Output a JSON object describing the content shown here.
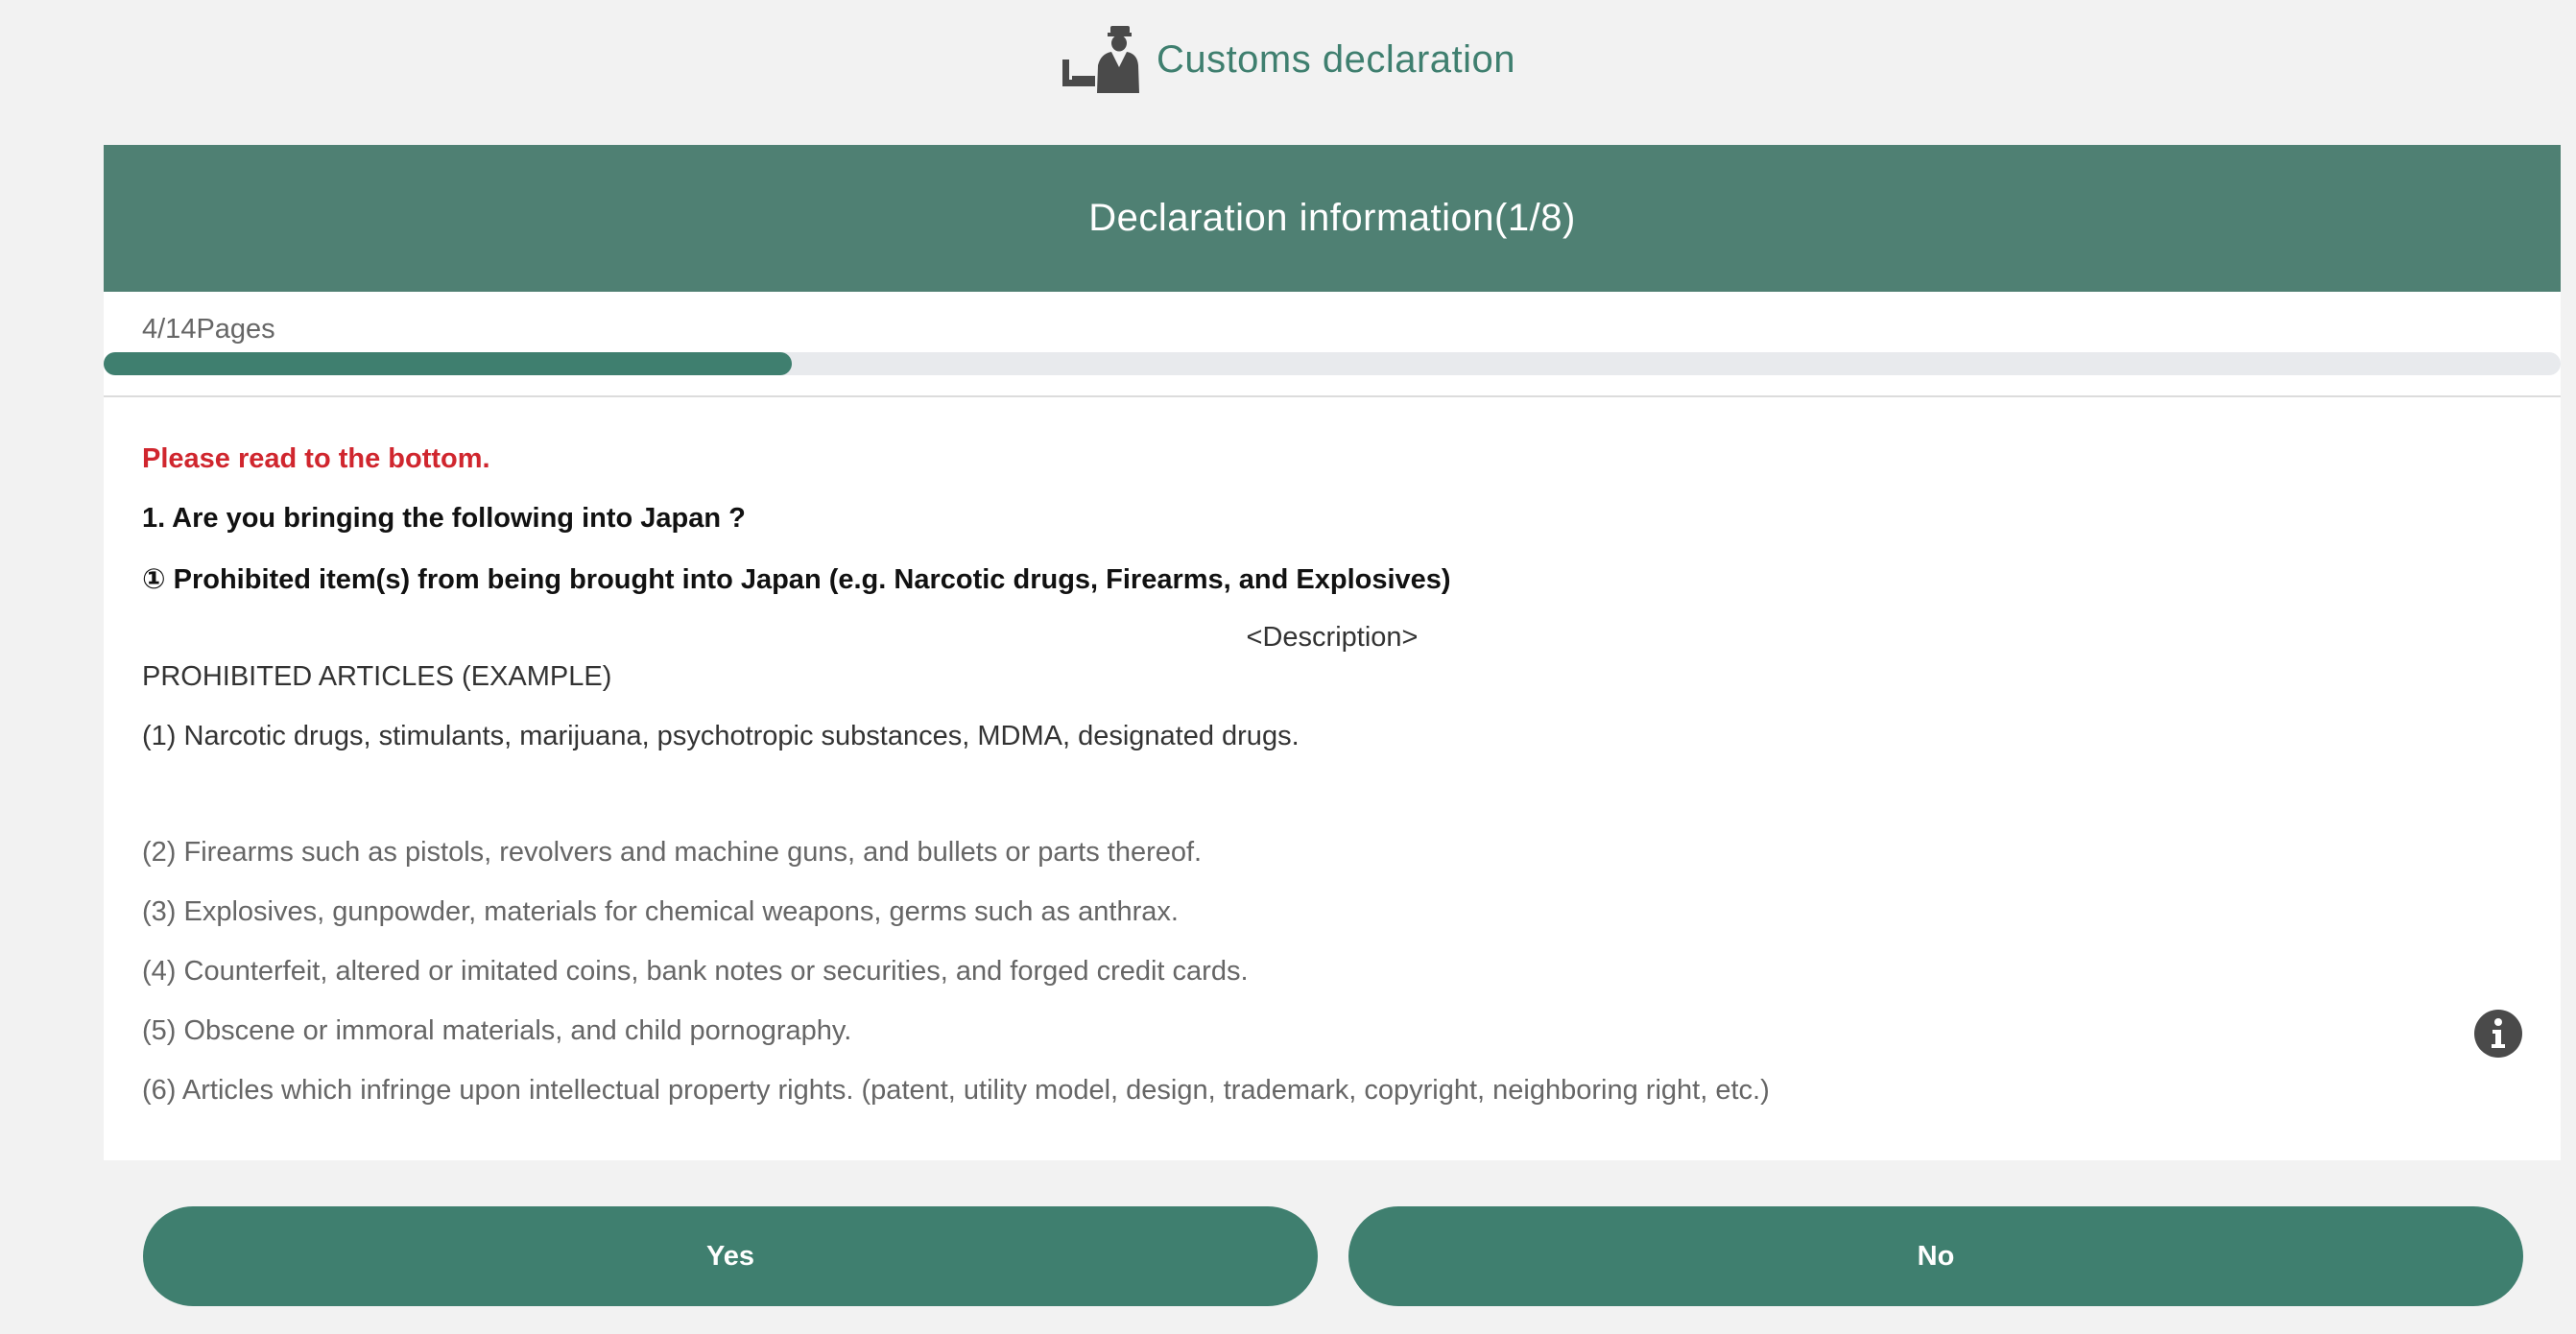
{
  "header": {
    "title": "Customs declaration",
    "icon": "customs-officer-icon",
    "accent_color": "#3f7f6f"
  },
  "panel": {
    "title": "Declaration information(1/8)",
    "header_color": "#4f8073"
  },
  "progress": {
    "label": "4/14Pages",
    "current": 4,
    "total": 14,
    "fill_fraction": 0.28
  },
  "content": {
    "warning": "Please read to the bottom.",
    "question": "1. Are you bringing the following into Japan ?",
    "subquestion": "① Prohibited item(s) from being brought into Japan (e.g. Narcotic drugs, Firearms, and Explosives)",
    "description_heading": "<Description>",
    "articles_heading": "PROHIBITED ARTICLES (EXAMPLE)",
    "items": [
      "(1) Narcotic drugs, stimulants, marijuana, psychotropic substances, MDMA, designated drugs.",
      "(2) Firearms such as pistols, revolvers and machine guns, and bullets or parts thereof.",
      "(3) Explosives, gunpowder, materials for chemical weapons, germs such as anthrax.",
      "(4) Counterfeit, altered or imitated coins, bank notes or securities, and forged credit cards.",
      "(5) Obscene or immoral materials, and child pornography.",
      "(6) Articles which infringe upon intellectual property rights. (patent, utility model, design, trademark, copyright, neighboring right, etc.)"
    ],
    "info_icon": "info-icon"
  },
  "buttons": {
    "yes_label": "Yes",
    "no_label": "No"
  }
}
